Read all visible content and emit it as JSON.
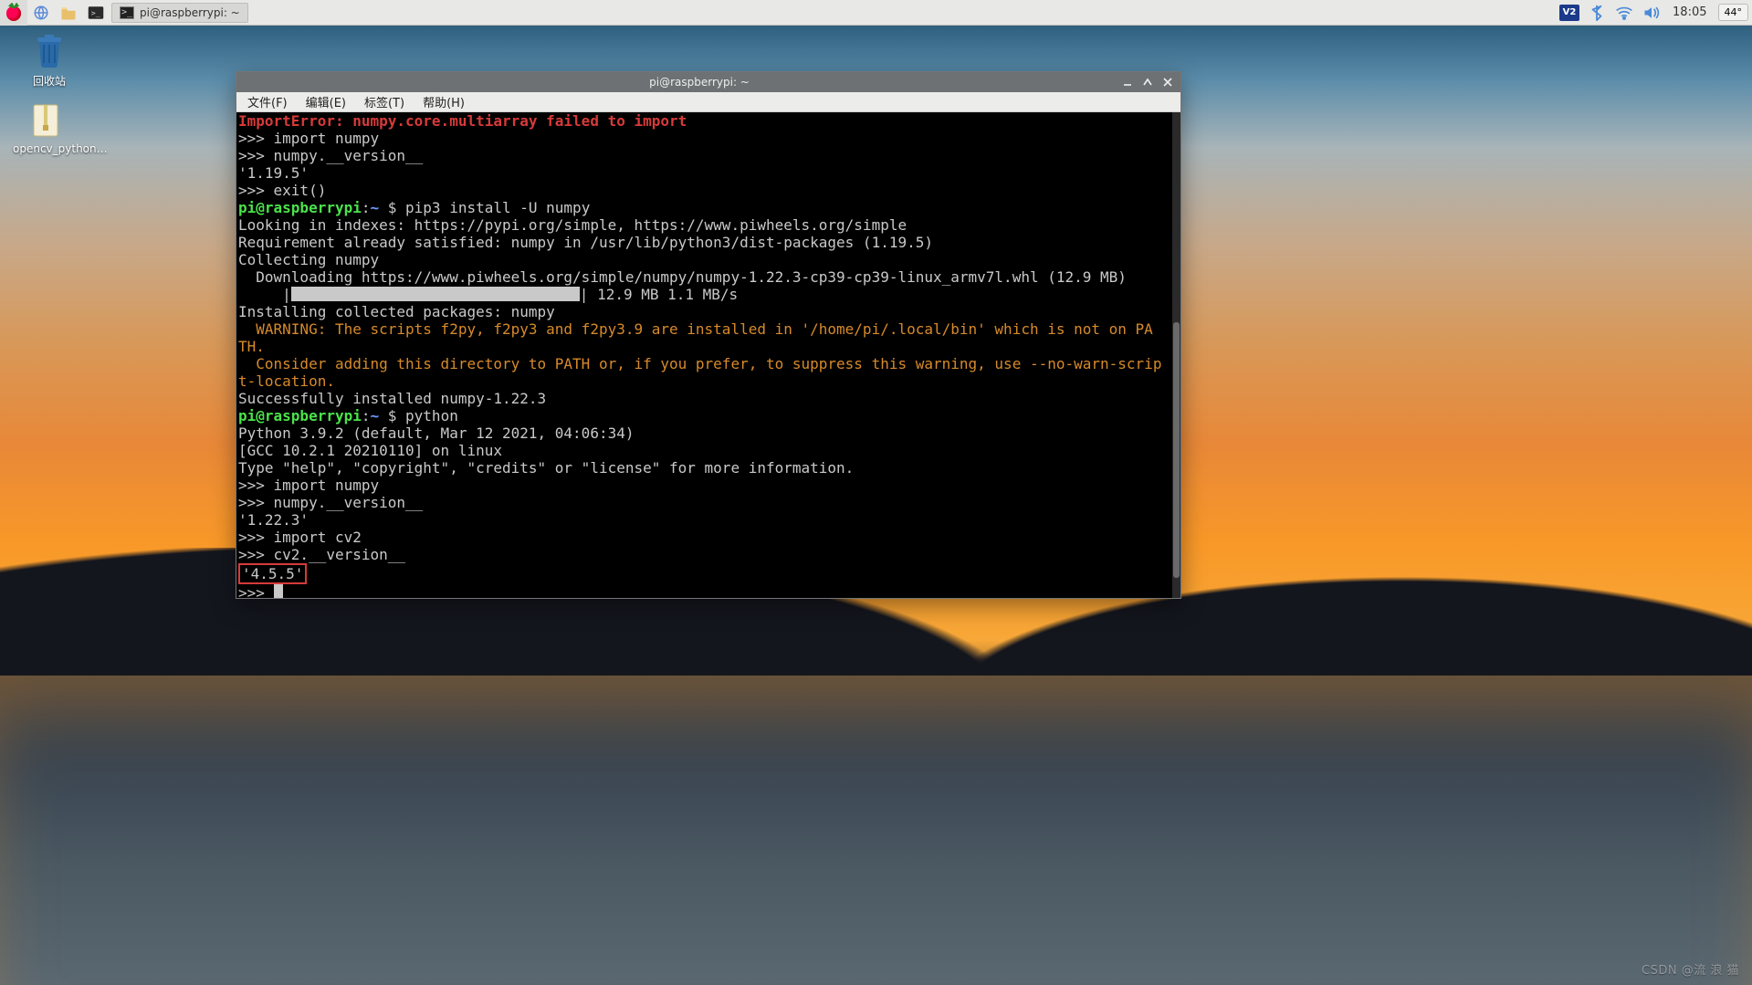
{
  "taskbar": {
    "task_label": "pi@raspberrypi: ~",
    "vnc": "V2",
    "clock": "18:05",
    "temp": "44°"
  },
  "desktop": {
    "trash": "回收站",
    "opencv_file": "opencv_python…"
  },
  "terminal": {
    "title": "pi@raspberrypi: ~",
    "menu": {
      "file": "文件(F)",
      "edit": "编辑(E)",
      "tabs": "标签(T)",
      "help": "帮助(H)"
    },
    "lines": {
      "l01": "ImportError: numpy.core.multiarray failed to import",
      "l02": ">>> import numpy",
      "l03": ">>> numpy.__version__",
      "l04": "'1.19.5'",
      "l05": ">>> exit()",
      "prompt1_user": "pi@raspberrypi",
      "prompt1_sep": ":",
      "prompt1_path": "~ ",
      "prompt1_dollar": "$ ",
      "cmd1": "pip3 install -U numpy",
      "l07": "Looking in indexes: https://pypi.org/simple, https://www.piwheels.org/simple",
      "l08": "Requirement already satisfied: numpy in /usr/lib/python3/dist-packages (1.19.5)",
      "l09": "Collecting numpy",
      "l10": "  Downloading https://www.piwheels.org/simple/numpy/numpy-1.22.3-cp39-cp39-linux_armv7l.whl (12.9 MB)",
      "l11a": "     |",
      "l11b": "| 12.9 MB 1.1 MB/s",
      "l12": "Installing collected packages: numpy",
      "l13": "  WARNING: The scripts f2py, f2py3 and f2py3.9 are installed in '/home/pi/.local/bin' which is not on PA",
      "l14": "TH.",
      "l15": "  Consider adding this directory to PATH or, if you prefer, to suppress this warning, use --no-warn-scrip",
      "l16": "t-location.",
      "l17": "Successfully installed numpy-1.22.3",
      "prompt2_user": "pi@raspberrypi",
      "prompt2_sep": ":",
      "prompt2_path": "~ ",
      "prompt2_dollar": "$ ",
      "cmd2": "python",
      "l19": "Python 3.9.2 (default, Mar 12 2021, 04:06:34)",
      "l20": "[GCC 10.2.1 20210110] on linux",
      "l21": "Type \"help\", \"copyright\", \"credits\" or \"license\" for more information.",
      "l22": ">>> import numpy",
      "l23": ">>> numpy.__version__",
      "l24": "'1.22.3'",
      "l25": ">>> import cv2",
      "l26": ">>> cv2.__version__",
      "l27": "'4.5.5'",
      "l28": ">>> "
    }
  },
  "watermark": "CSDN @流 浪 猫"
}
